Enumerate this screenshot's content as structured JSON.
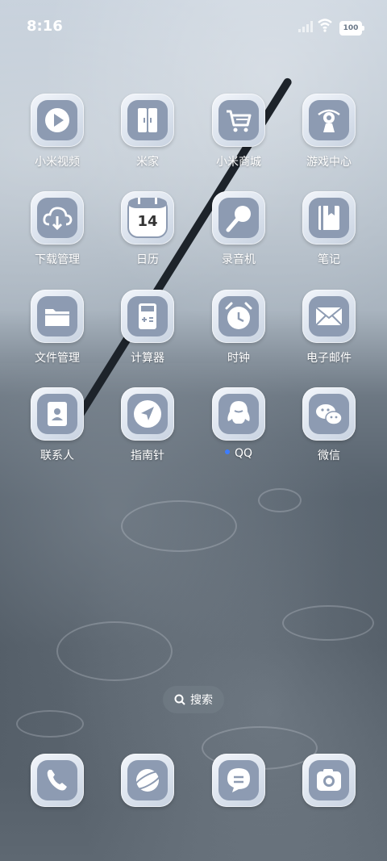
{
  "status_bar": {
    "time": "8:16",
    "battery": "100"
  },
  "apps": [
    {
      "label": "小米视频",
      "icon": "video-play-icon"
    },
    {
      "label": "米家",
      "icon": "mijia-door-icon"
    },
    {
      "label": "小米商城",
      "icon": "shopping-cart-icon"
    },
    {
      "label": "游戏中心",
      "icon": "game-center-icon"
    },
    {
      "label": "下载管理",
      "icon": "cloud-download-icon"
    },
    {
      "label": "日历",
      "icon": "calendar-icon",
      "day": "14"
    },
    {
      "label": "录音机",
      "icon": "microphone-icon"
    },
    {
      "label": "笔记",
      "icon": "notebook-icon"
    },
    {
      "label": "文件管理",
      "icon": "folder-icon"
    },
    {
      "label": "计算器",
      "icon": "calculator-icon"
    },
    {
      "label": "时钟",
      "icon": "alarm-clock-icon"
    },
    {
      "label": "电子邮件",
      "icon": "mail-icon"
    },
    {
      "label": "联系人",
      "icon": "contacts-icon"
    },
    {
      "label": "指南针",
      "icon": "compass-icon"
    },
    {
      "label": "QQ",
      "icon": "qq-penguin-icon",
      "new_badge": true
    },
    {
      "label": "微信",
      "icon": "wechat-icon"
    }
  ],
  "search": {
    "label": "搜索"
  },
  "dock": [
    {
      "icon": "phone-icon"
    },
    {
      "icon": "browser-planet-icon"
    },
    {
      "icon": "message-icon"
    },
    {
      "icon": "camera-icon"
    }
  ],
  "colors": {
    "icon_fg": "#ffffff",
    "icon_bg": "#8d9bb2",
    "badge_dot": "#3d7dff"
  }
}
